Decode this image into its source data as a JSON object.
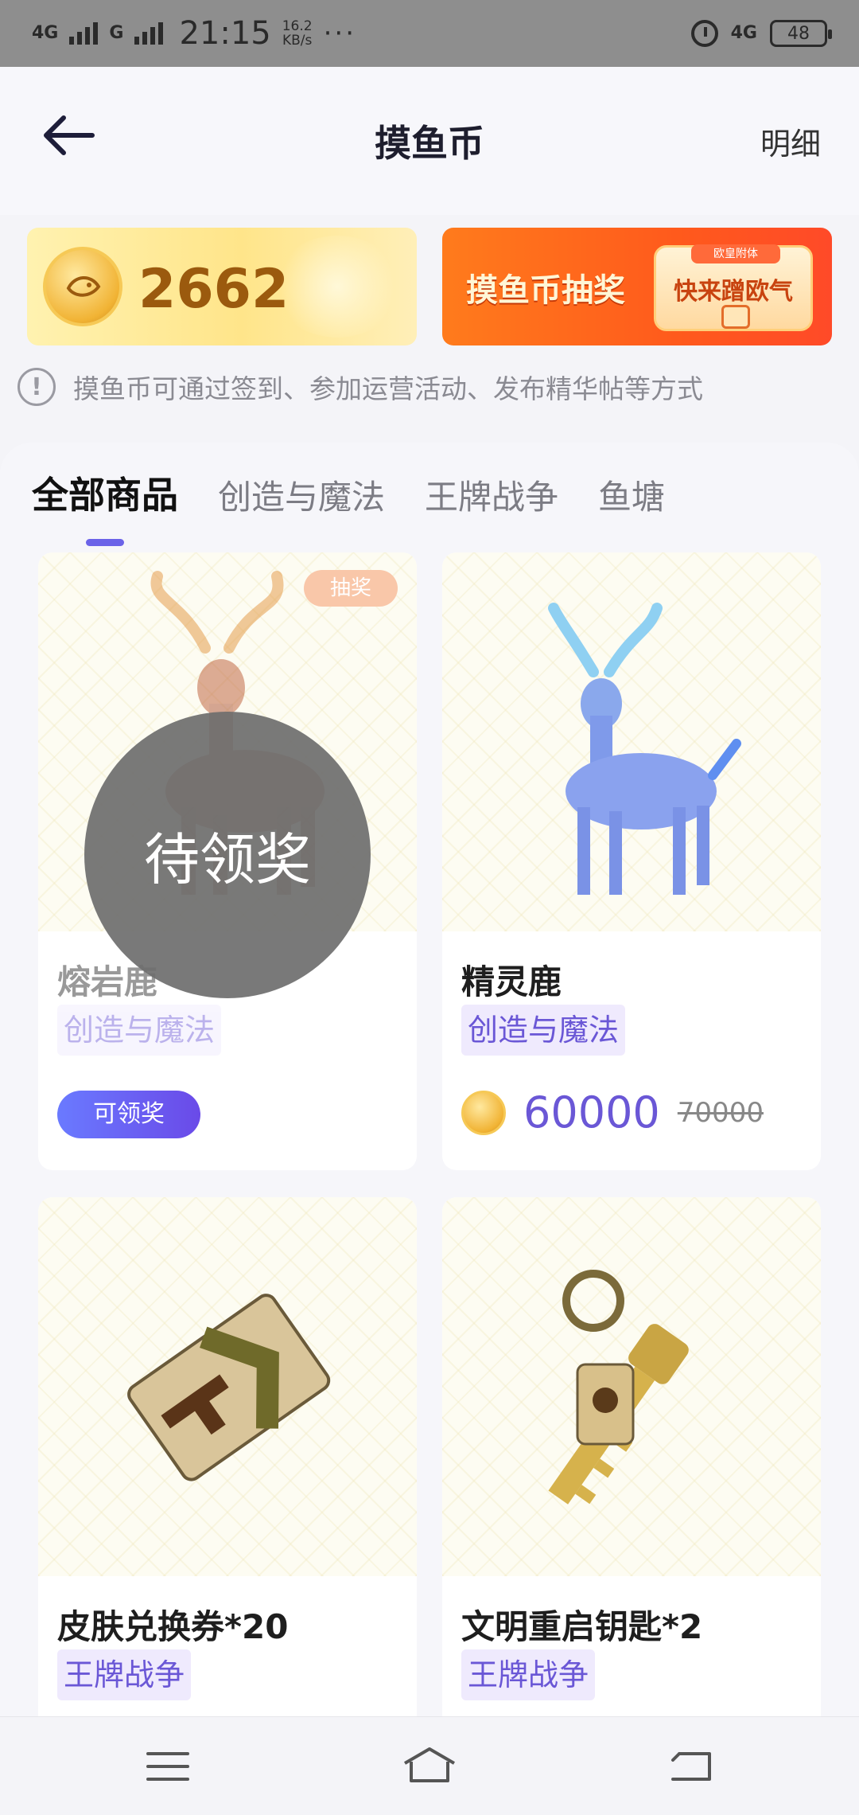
{
  "status": {
    "net1": "4G",
    "net2": "G",
    "time": "21:15",
    "speed_value": "16.2",
    "speed_unit": "KB/s",
    "more": "···",
    "net_right": "4G",
    "battery": "48"
  },
  "header": {
    "title": "摸鱼币",
    "detail": "明细"
  },
  "coins": {
    "balance": "2662"
  },
  "lottery_banner": {
    "title": "摸鱼币抽奖",
    "box_tag": "欧皇附体",
    "box_text": "快来蹭欧气"
  },
  "notice": {
    "icon_text": "!",
    "text": "摸鱼币可通过签到、参加运营活动、发布精华帖等方式"
  },
  "tabs": [
    {
      "label": "全部商品",
      "active": true
    },
    {
      "label": "创造与魔法",
      "active": false
    },
    {
      "label": "王牌战争",
      "active": false
    },
    {
      "label": "鱼塘",
      "active": false
    }
  ],
  "products": [
    {
      "name": "熔岩鹿",
      "category": "创造与魔法",
      "tag": "抽奖",
      "overlay": "待领奖",
      "claim_label": "可领奖"
    },
    {
      "name": "精灵鹿",
      "category": "创造与魔法",
      "price": "60000",
      "original_price": "70000"
    },
    {
      "name": "皮肤兑换券*20",
      "category": "王牌战争"
    },
    {
      "name": "文明重启钥匙*2",
      "category": "王牌战争"
    }
  ],
  "colors": {
    "accent": "#6a57d6",
    "tab_indicator": "#6b63e8",
    "lottery_orange": "#ff5a1c"
  }
}
